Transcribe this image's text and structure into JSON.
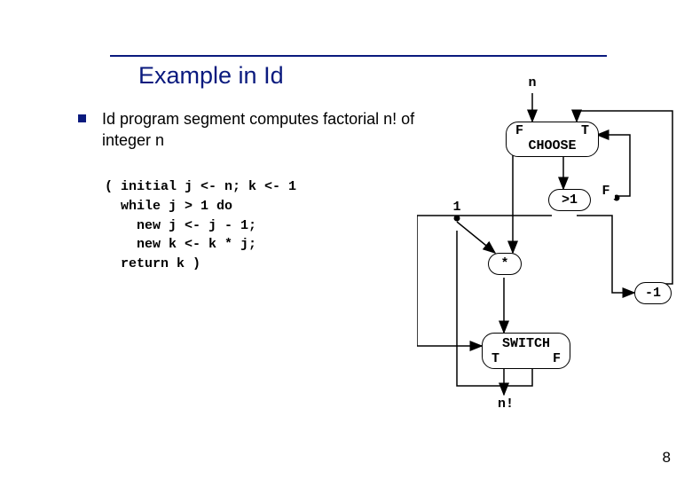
{
  "title": "Example in Id",
  "bullet": "Id program segment computes factorial n! of integer n",
  "code": "( initial j <- n; k <- 1\n  while j > 1 do\n    new j <- j - 1;\n    new k <- k * j;\n  return k )",
  "slide_number": "8",
  "diagram": {
    "input": "n",
    "choose": {
      "left": "F",
      "right": "T",
      "label": "CHOOSE"
    },
    "one": "1",
    "gt1": {
      "label": ">1",
      "out": "F"
    },
    "star": "*",
    "minus1": "-1",
    "switch": {
      "label": "SWITCH",
      "left": "T",
      "right": "F"
    },
    "output": "n!"
  }
}
